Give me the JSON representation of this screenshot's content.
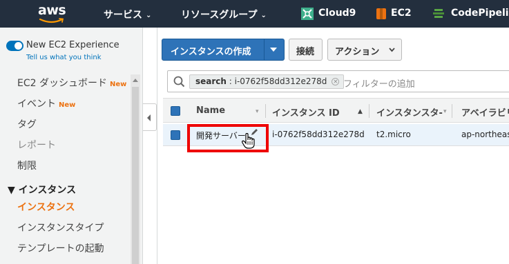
{
  "topnav": {
    "logo_text": "aws",
    "services_label": "サービス",
    "resource_groups_label": "リソースグループ",
    "pinned": [
      {
        "label": "Cloud9",
        "icon": "cloud9-icon",
        "color": "#3fb08c"
      },
      {
        "label": "EC2",
        "icon": "ec2-icon",
        "color": "#ec7211"
      },
      {
        "label": "CodePipelin",
        "icon": "codepipeline-icon",
        "color": "#5aa845"
      }
    ],
    "caret": "⌄"
  },
  "sidebar": {
    "experience_title": "New EC2 Experience",
    "experience_link": "Tell us what you think",
    "items": [
      {
        "label": "EC2 ダッシュボード",
        "badge": "New"
      },
      {
        "label": "イベント",
        "badge": "New"
      },
      {
        "label": "タグ"
      },
      {
        "label": "レポート"
      },
      {
        "label": "制限"
      }
    ],
    "section_title": "▼ インスタンス",
    "section_items": [
      {
        "label": "インスタンス",
        "active": true
      },
      {
        "label": "インスタンスタイプ"
      },
      {
        "label": "テンプレートの起動"
      }
    ]
  },
  "toolbar": {
    "create_label": "インスタンスの作成",
    "connect_label": "接続",
    "actions_label": "アクション"
  },
  "filter": {
    "chip_key": "search",
    "chip_value": " : i-0762f58dd312e278d",
    "chip_close": "✕",
    "placeholder": "フィルターの追加"
  },
  "table": {
    "columns": [
      "Name",
      "インスタンス ID",
      "インスタンスタ-",
      "アベイラビリ"
    ],
    "rows": [
      {
        "name": "開発サーバー",
        "instance_id": "i-0762f58dd312e278d",
        "type": "t2.micro",
        "az": "ap-northeast"
      }
    ]
  },
  "colors": {
    "nav_bg": "#232f3e",
    "primary": "#2e73b8",
    "accent": "#ec7211",
    "highlight": "#e00000"
  }
}
